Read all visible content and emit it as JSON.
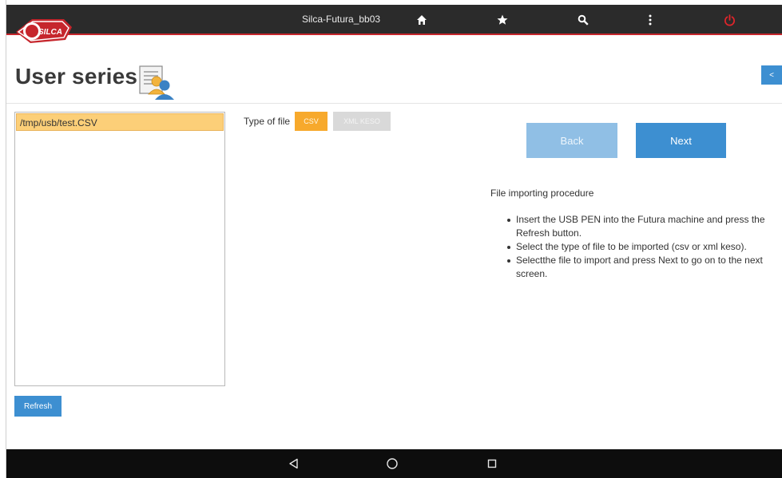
{
  "topbar": {
    "brand_name": "SILCA",
    "device_title": "Silca-Futura_bb03",
    "icons": [
      "home-icon",
      "star-icon",
      "search-icon",
      "more-vert-icon",
      "power-icon"
    ],
    "accent_color": "#c6262c"
  },
  "header": {
    "title": "User series",
    "collapse_label": "<"
  },
  "file_list": {
    "items": [
      "/tmp/usb/test.CSV"
    ],
    "selected_index": 0
  },
  "refresh_label": "Refresh",
  "file_type": {
    "label": "Type of file",
    "options": [
      "CSV",
      "XML KESO"
    ],
    "selected": "CSV"
  },
  "nav": {
    "back_label": "Back",
    "next_label": "Next"
  },
  "instructions": {
    "title": "File importing procedure",
    "steps": [
      "Insert the USB PEN into the Futura machine and press the Refresh button.",
      "Select the type of file to be imported (csv or xml keso).",
      "Selectthe file to import and press Next to go on to the next screen."
    ]
  },
  "colors": {
    "primary_blue": "#3d8fd1",
    "disabled_blue": "#90bfe5",
    "selected_orange": "#f7a92c",
    "selected_row": "#fccf78"
  },
  "system_nav": {
    "icons": [
      "android-back-icon",
      "android-home-icon",
      "android-recents-icon"
    ]
  }
}
